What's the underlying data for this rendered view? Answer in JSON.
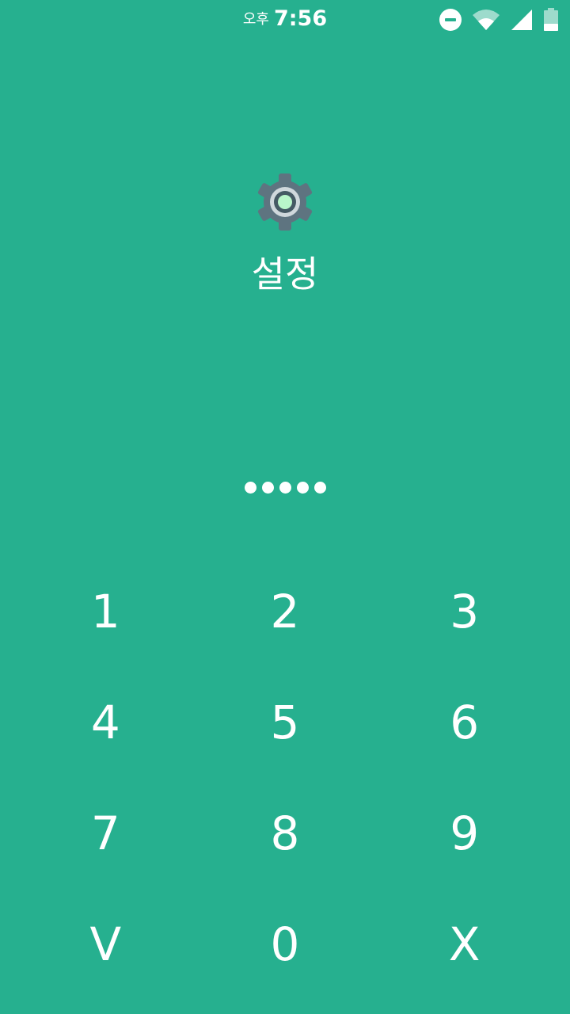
{
  "status_bar": {
    "ampm": "오후",
    "time": "7:56",
    "icons": [
      "do-not-disturb-icon",
      "wifi-icon",
      "cellular-signal-icon",
      "battery-icon"
    ]
  },
  "app": {
    "icon": "settings-gear-icon",
    "title": "설정"
  },
  "pin": {
    "entered_count": 5
  },
  "keypad": {
    "keys": [
      "1",
      "2",
      "3",
      "4",
      "5",
      "6",
      "7",
      "8",
      "9",
      "V",
      "0",
      "X"
    ]
  },
  "colors": {
    "background": "#26b08f",
    "foreground": "#ffffff",
    "gear": "#607d8b",
    "gear_center": "#b9f6ca"
  }
}
